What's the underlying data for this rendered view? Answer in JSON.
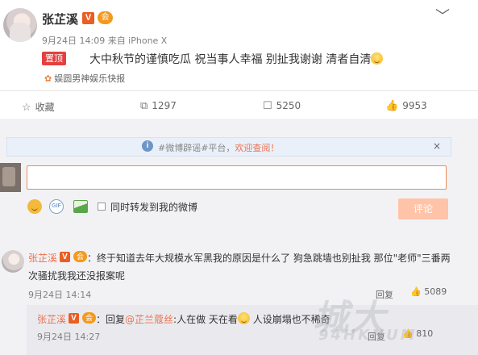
{
  "post": {
    "author": "张芷溪",
    "verified_badge": "V",
    "vip_badge": "会",
    "meta": "9月24日 14:09 来自 iPhone X",
    "pinned_label": "置顶",
    "text": "大中秋节的谨慎吃瓜 祝当事人幸福 别扯我谢谢 清者自清",
    "source": "娱圆男神娱乐快报",
    "chevron": "﹀"
  },
  "actions": {
    "favorite_label": "收藏",
    "repost_count": "1297",
    "comment_count": "5250",
    "like_count": "9953"
  },
  "notice": {
    "info_glyph": "i",
    "prefix": "#微博辟谣#平台，",
    "link": "欢迎查阅！",
    "close": "×"
  },
  "composer": {
    "gif_label": "GIF",
    "repost_checkbox_label": "同时转发到我的微博",
    "submit_label": "评论"
  },
  "comments": [
    {
      "author": "张芷溪",
      "line1": "：终于知道去年大规模水军黑我的原因是什么了 狗急跳墙也别扯我 那位\"老师\"三番两",
      "line2": "次骚扰我我还没报案呢",
      "time": "9月24日 14:14",
      "reply_label": "回复",
      "like_count": "5089"
    }
  ],
  "reply": {
    "author": "张芷溪",
    "prefix": "：回复",
    "mention": "@芷兰蔻丝",
    "text_before": ":人在做 天在看",
    "text_after": " 人设崩塌也不稀奇",
    "time": "9月24日 14:27",
    "reply_label": "回复",
    "like_count": "810"
  },
  "watermark": {
    "main": "城大",
    "sub": "94HKNUM"
  },
  "icons": {
    "star": "star-icon",
    "repost": "repost-icon",
    "comment": "comment-icon",
    "like": "thumbs-up-icon",
    "smile": "smile-icon",
    "gif": "gif-icon",
    "image": "image-icon",
    "info": "info-icon",
    "close": "close-icon"
  },
  "colors": {
    "accent": "#eb7350",
    "pinned": "#e63f3f",
    "submit": "#ffc3a8"
  }
}
